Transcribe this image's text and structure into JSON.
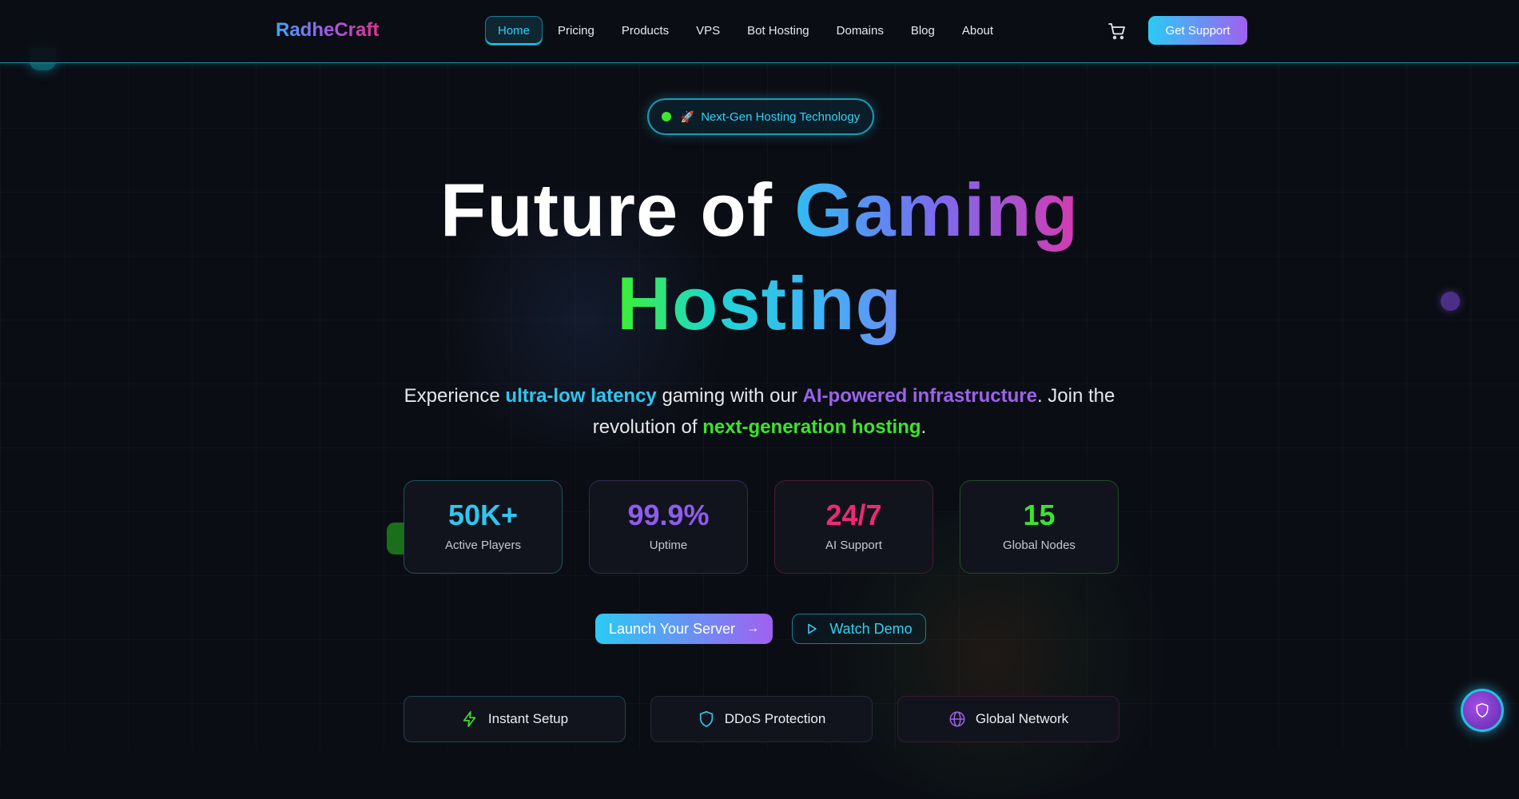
{
  "brand": {
    "name": "RadheCraft"
  },
  "nav": {
    "items": [
      {
        "label": "Home",
        "active": true
      },
      {
        "label": "Pricing"
      },
      {
        "label": "Products"
      },
      {
        "label": "VPS"
      },
      {
        "label": "Bot Hosting"
      },
      {
        "label": "Domains"
      },
      {
        "label": "Blog"
      },
      {
        "label": "About"
      }
    ],
    "cart_icon": "cart-icon",
    "support_label": "Get Support"
  },
  "hero": {
    "badge_text": "Next-Gen Hosting Technology",
    "badge_icon": "🚀",
    "title_line1_white": "Future of",
    "title_line1_grad": "Gaming",
    "title_line2": "Hosting",
    "sub_1": "Experience ",
    "sub_h1": "ultra-low latency",
    "sub_2": " gaming with our ",
    "sub_h2": "AI-powered infrastructure",
    "sub_3": ". Join the revolution of ",
    "sub_h3": "next-generation hosting",
    "sub_4": "."
  },
  "stats": [
    {
      "value": "50K+",
      "label": "Active Players",
      "color": "#2fc6f0"
    },
    {
      "value": "99.9%",
      "label": "Uptime",
      "color": "#8f5cf0"
    },
    {
      "value": "24/7",
      "label": "AI Support",
      "color": "#ee2a74"
    },
    {
      "value": "15",
      "label": "Global Nodes",
      "color": "#3de42b"
    }
  ],
  "cta": {
    "launch_label": "Launch Your Server",
    "launch_icon": "arrow-right-icon",
    "demo_label": "Watch Demo",
    "demo_icon": "play-icon"
  },
  "features": [
    {
      "label": "Instant Setup",
      "icon": "lightning-icon",
      "color": "#3de42b"
    },
    {
      "label": "DDoS Protection",
      "icon": "shield-icon",
      "color": "#2fc6f0"
    },
    {
      "label": "Global Network",
      "icon": "globe-icon",
      "color": "#9b63ec"
    }
  ],
  "fab": {
    "icon": "shield-icon"
  }
}
